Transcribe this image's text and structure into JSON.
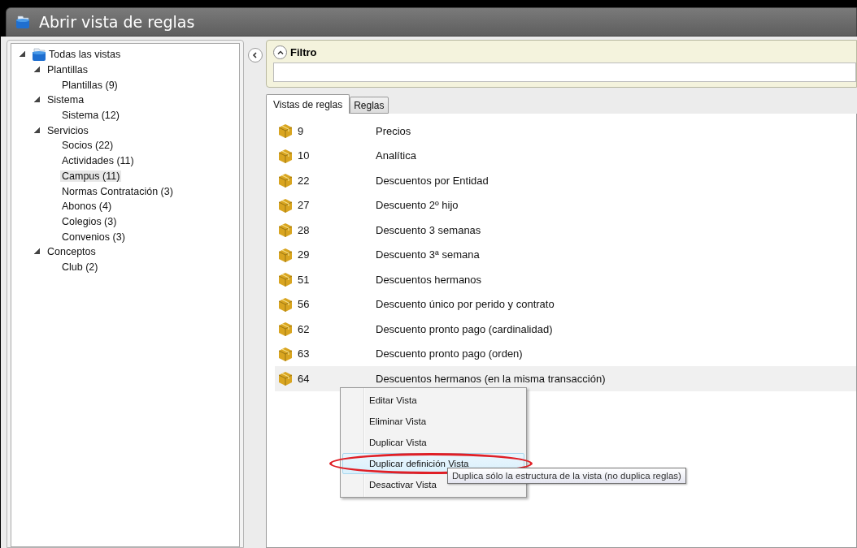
{
  "window": {
    "title": "Abrir vista de reglas"
  },
  "tree": [
    {
      "label": "Todas las vistas",
      "kind": "root",
      "expanded": true,
      "selected": false,
      "children": [
        {
          "label": "Plantillas",
          "kind": "group",
          "expanded": true,
          "selected": false,
          "children": [
            {
              "label": "Plantillas (9)",
              "kind": "leaf",
              "selected": false
            }
          ]
        },
        {
          "label": "Sistema",
          "kind": "group",
          "expanded": true,
          "selected": false,
          "children": [
            {
              "label": "Sistema (12)",
              "kind": "leaf",
              "selected": false
            }
          ]
        },
        {
          "label": "Servicios",
          "kind": "group",
          "expanded": true,
          "selected": false,
          "children": [
            {
              "label": "Socios (22)",
              "kind": "leaf",
              "selected": false
            },
            {
              "label": "Actividades (11)",
              "kind": "leaf",
              "selected": false
            },
            {
              "label": "Campus (11)",
              "kind": "leaf",
              "selected": true
            },
            {
              "label": "Normas Contratación (3)",
              "kind": "leaf",
              "selected": false
            },
            {
              "label": "Abonos (4)",
              "kind": "leaf",
              "selected": false
            },
            {
              "label": "Colegios (3)",
              "kind": "leaf",
              "selected": false
            },
            {
              "label": "Convenios (3)",
              "kind": "leaf",
              "selected": false
            }
          ]
        },
        {
          "label": "Conceptos",
          "kind": "group",
          "expanded": true,
          "selected": false,
          "children": [
            {
              "label": "Club (2)",
              "kind": "leaf",
              "selected": false
            }
          ]
        }
      ]
    }
  ],
  "filter": {
    "title": "Filtro",
    "expanded": true
  },
  "tabs": [
    {
      "label": "Vistas de reglas",
      "selected": true
    },
    {
      "label": "Reglas",
      "selected": false
    }
  ],
  "rows": [
    {
      "id": "9",
      "name": "Precios",
      "selected": false
    },
    {
      "id": "10",
      "name": "Analítica",
      "selected": false
    },
    {
      "id": "22",
      "name": "Descuentos por Entidad",
      "selected": false
    },
    {
      "id": "27",
      "name": "Descuento 2º hijo",
      "selected": false
    },
    {
      "id": "28",
      "name": "Descuento 3 semanas",
      "selected": false
    },
    {
      "id": "29",
      "name": "Descuento 3ª semana",
      "selected": false
    },
    {
      "id": "51",
      "name": "Descuentos hermanos",
      "selected": false
    },
    {
      "id": "56",
      "name": "Descuento único por perido y contrato",
      "selected": false
    },
    {
      "id": "62",
      "name": "Descuento pronto pago (cardinalidad)",
      "selected": false
    },
    {
      "id": "63",
      "name": "Descuento pronto pago (orden)",
      "selected": false
    },
    {
      "id": "64",
      "name": "Descuentos hermanos (en la misma transacción)",
      "selected": true
    }
  ],
  "context_menu": {
    "items": [
      {
        "label": "Editar Vista",
        "selected": false,
        "circled": false
      },
      {
        "label": "Eliminar Vista",
        "selected": false,
        "circled": false
      },
      {
        "label": "Duplicar Vista",
        "selected": false,
        "circled": false
      },
      {
        "label": "Duplicar definición Vista",
        "selected": true,
        "circled": true
      },
      {
        "label": "Desactivar Vista",
        "selected": false,
        "circled": false
      }
    ]
  },
  "tooltip": "Duplica sólo la estructura de la vista (no duplica reglas)"
}
